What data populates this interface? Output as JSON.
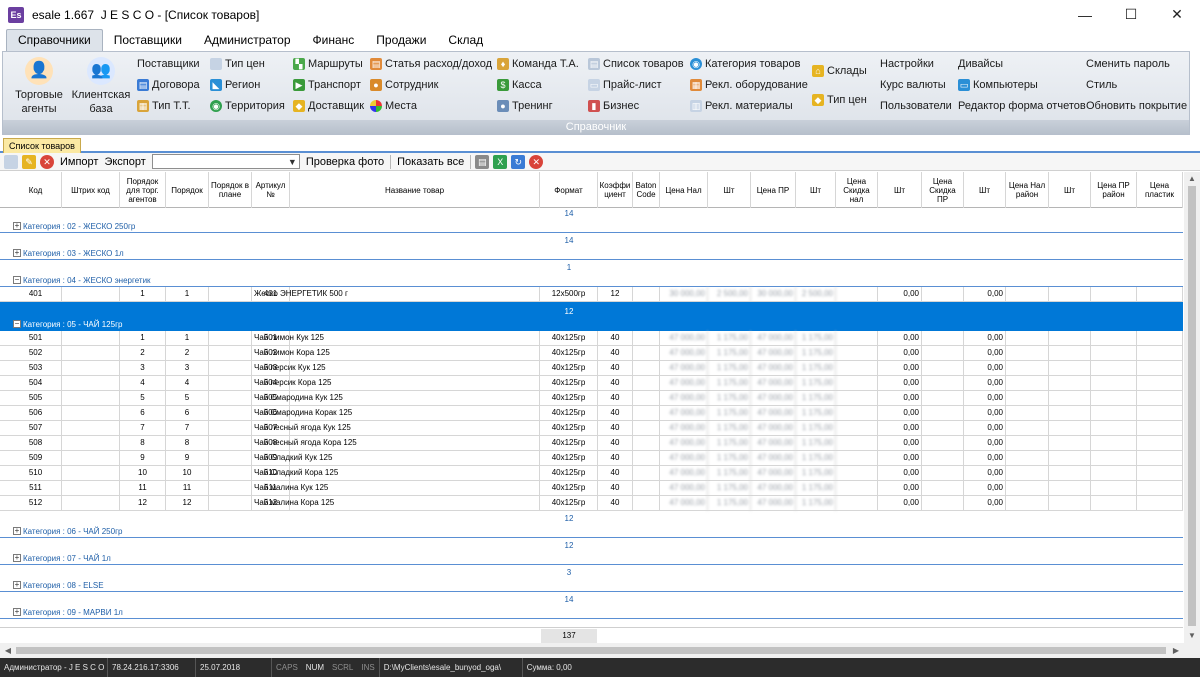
{
  "window": {
    "app_icon": "Es",
    "title": "esale 1.667  J E S C O - [Список товаров]",
    "minimize": "—",
    "maximize": "☐",
    "close": "✕"
  },
  "ribbon_tabs": [
    "Справочники",
    "Поставщики",
    "Администратор",
    "Финанс",
    "Продажи",
    "Склад"
  ],
  "ribbon": {
    "caption": "Справочник",
    "big_buttons": [
      {
        "label1": "Торговые",
        "label2": "агенты",
        "icon": "sales-agent-icon"
      },
      {
        "label1": "Клиентская",
        "label2": "база",
        "icon": "client-base-icon"
      }
    ],
    "col1": [
      "Поставщики",
      "Договора",
      "Тип Т.Т."
    ],
    "col2": [
      "Тип цен",
      "Регион",
      "Территория"
    ],
    "col3": [
      "Маршруты",
      "Транспорт",
      "Доставщик"
    ],
    "col4": [
      "Статья расход/доход",
      "Сотрудник",
      "Места"
    ],
    "col5": [
      "Команда Т.А.",
      "Касса",
      "Тренинг"
    ],
    "col6": [
      "Список товаров",
      "Прайс-лист",
      "Бизнес"
    ],
    "col7": [
      "Категория товаров",
      "Рекл. оборудование",
      "Рекл. материалы"
    ],
    "col8": [
      "Склады",
      "Тип цен"
    ],
    "col9": [
      "Настройки",
      "Курс валюты",
      "Пользователи"
    ],
    "col10": [
      "Дивайсы",
      "Компьютеры",
      "Редактор форма отчетов"
    ],
    "col11": [
      "Сменить пароль",
      "Стиль",
      "Обновить покрытие"
    ]
  },
  "doc_tab": "Список товаров",
  "toolbar": {
    "import": "Импорт",
    "export": "Экспорт",
    "combo_value": "",
    "check_photo": "Проверка фото",
    "show_all": "Показать все"
  },
  "grid": {
    "headers": [
      "Код",
      "Штрих код",
      "Порядок для торг. агентов",
      "Порядок",
      "Порядок в плане",
      "Артикул №",
      "Название товар",
      "Формат",
      "Коэффи циент",
      "Baton Code",
      "Цена Нал",
      "Шт",
      "Цена ПР",
      "Шт",
      "Цена Скидка нал",
      "Шт",
      "Цена Скидка ПР",
      "Шт",
      "Цена Нал район",
      "Шт",
      "Цена ПР район",
      "Цена пластик"
    ],
    "groups": [
      {
        "label": "Категория : 02 - ЖЕСКО 250гр",
        "count": "14",
        "sign": "+"
      },
      {
        "label": "Категория : 03 - ЖЕСКО 1л",
        "count": "14",
        "sign": "+"
      },
      {
        "label": "Категория : 04 - ЖЕСКО энергетик",
        "count": "1",
        "sign": "−"
      },
      {
        "label": "Категория : 05 - ЧАЙ 125гр",
        "count": "12",
        "sign": "−"
      },
      {
        "label": "Категория : 06 - ЧАЙ 250гр",
        "count": "12",
        "sign": "+"
      },
      {
        "label": "Категория : 07 - ЧАЙ 1л",
        "count": "12",
        "sign": "+"
      },
      {
        "label": "Категория : 08 - ELSE",
        "count": "3",
        "sign": "+"
      },
      {
        "label": "Категория : 09 - МАРВИ 1л",
        "count": "14",
        "sign": "+"
      }
    ],
    "group04_rows": [
      {
        "code": "401",
        "order_agents": "1",
        "order": "1",
        "article": "401",
        "name": "Жеско ЭНЕРГЕТИК  500 г",
        "format": "12x500гр",
        "coef": "12",
        "price_cash": "30 000,00",
        "qty1": "2 500,00",
        "price_pr": "30 000,00",
        "qty2": "2 500,00",
        "disc_cash_qty": "0,00",
        "disc_pr_qty": "0,00"
      }
    ],
    "group05_rows": [
      {
        "code": "501",
        "order_agents": "1",
        "order": "1",
        "article": "501",
        "name": "Чай лимон Кук 125",
        "format": "40x125гр",
        "coef": "40",
        "price_cash": "47 000,00",
        "qty1": "1 175,00",
        "price_pr": "47 000,00",
        "qty2": "1 175,00",
        "disc_cash_qty": "0,00",
        "disc_pr_qty": "0,00"
      },
      {
        "code": "502",
        "order_agents": "2",
        "order": "2",
        "article": "502",
        "name": "Чай лимон Кора 125",
        "format": "40x125гр",
        "coef": "40",
        "price_cash": "47 000,00",
        "qty1": "1 175,00",
        "price_pr": "47 000,00",
        "qty2": "1 175,00",
        "disc_cash_qty": "0,00",
        "disc_pr_qty": "0,00"
      },
      {
        "code": "503",
        "order_agents": "3",
        "order": "3",
        "article": "503",
        "name": "Чай персик Кук  125",
        "format": "40x125гр",
        "coef": "40",
        "price_cash": "47 000,00",
        "qty1": "1 175,00",
        "price_pr": "47 000,00",
        "qty2": "1 175,00",
        "disc_cash_qty": "0,00",
        "disc_pr_qty": "0,00"
      },
      {
        "code": "504",
        "order_agents": "4",
        "order": "4",
        "article": "504",
        "name": "Чай персик Кора 125",
        "format": "40x125гр",
        "coef": "40",
        "price_cash": "47 000,00",
        "qty1": "1 175,00",
        "price_pr": "47 000,00",
        "qty2": "1 175,00",
        "disc_cash_qty": "0,00",
        "disc_pr_qty": "0,00"
      },
      {
        "code": "505",
        "order_agents": "5",
        "order": "5",
        "article": "505",
        "name": "Чай Смародина Кук 125",
        "format": "40x125гр",
        "coef": "40",
        "price_cash": "47 000,00",
        "qty1": "1 175,00",
        "price_pr": "47 000,00",
        "qty2": "1 175,00",
        "disc_cash_qty": "0,00",
        "disc_pr_qty": "0,00"
      },
      {
        "code": "506",
        "order_agents": "6",
        "order": "6",
        "article": "506",
        "name": "Чай Смародина Корак 125",
        "format": "40x125гр",
        "coef": "40",
        "price_cash": "47 000,00",
        "qty1": "1 175,00",
        "price_pr": "47 000,00",
        "qty2": "1 175,00",
        "disc_cash_qty": "0,00",
        "disc_pr_qty": "0,00"
      },
      {
        "code": "507",
        "order_agents": "7",
        "order": "7",
        "article": "507",
        "name": "Чай лесный ягода Кук 125",
        "format": "40x125гр",
        "coef": "40",
        "price_cash": "47 000,00",
        "qty1": "1 175,00",
        "price_pr": "47 000,00",
        "qty2": "1 175,00",
        "disc_cash_qty": "0,00",
        "disc_pr_qty": "0,00"
      },
      {
        "code": "508",
        "order_agents": "8",
        "order": "8",
        "article": "508",
        "name": "Чай лесный ягода Кора 125",
        "format": "40x125гр",
        "coef": "40",
        "price_cash": "47 000,00",
        "qty1": "1 175,00",
        "price_pr": "47 000,00",
        "qty2": "1 175,00",
        "disc_cash_qty": "0,00",
        "disc_pr_qty": "0,00"
      },
      {
        "code": "509",
        "order_agents": "9",
        "order": "9",
        "article": "509",
        "name": "Чай Сладкий Кук 125",
        "format": "40x125гр",
        "coef": "40",
        "price_cash": "47 000,00",
        "qty1": "1 175,00",
        "price_pr": "47 000,00",
        "qty2": "1 175,00",
        "disc_cash_qty": "0,00",
        "disc_pr_qty": "0,00"
      },
      {
        "code": "510",
        "order_agents": "10",
        "order": "10",
        "article": "510",
        "name": "Чай Сладкий Кора 125",
        "format": "40x125гр",
        "coef": "40",
        "price_cash": "47 000,00",
        "qty1": "1 175,00",
        "price_pr": "47 000,00",
        "qty2": "1 175,00",
        "disc_cash_qty": "0,00",
        "disc_pr_qty": "0,00"
      },
      {
        "code": "511",
        "order_agents": "11",
        "order": "11",
        "article": "511",
        "name": "Чай малина Кук 125",
        "format": "40x125гр",
        "coef": "40",
        "price_cash": "47 000,00",
        "qty1": "1 175,00",
        "price_pr": "47 000,00",
        "qty2": "1 175,00",
        "disc_cash_qty": "0,00",
        "disc_pr_qty": "0,00"
      },
      {
        "code": "512",
        "order_agents": "12",
        "order": "12",
        "article": "512",
        "name": "Чай малина Кора 125",
        "format": "40x125гр",
        "coef": "40",
        "price_cash": "47 000,00",
        "qty1": "1 175,00",
        "price_pr": "47 000,00",
        "qty2": "1 175,00",
        "disc_cash_qty": "0,00",
        "disc_pr_qty": "0,00"
      }
    ],
    "total": "137"
  },
  "status": {
    "user": "Администратор - J E S C O",
    "server": "78.24.216.17:3306",
    "date": "25.07.2018",
    "caps": "CAPS",
    "num": "NUM",
    "scrl": "SCRL",
    "ins": "INS",
    "path": "D:\\MyClients\\esale_bunyod_oga\\",
    "sum": "Сумма: 0,00"
  },
  "colors": {
    "accent": "#0078d7",
    "group_text": "#1f5fa8",
    "status_bg": "#2c2c2c"
  }
}
